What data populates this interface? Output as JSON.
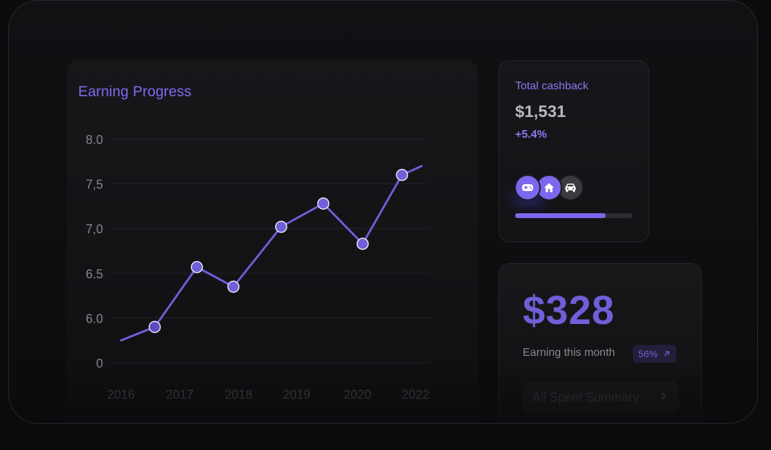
{
  "earning_card": {
    "title": "Earning Progress"
  },
  "chart_data": {
    "type": "line",
    "title": "Earning Progress",
    "y_tick_labels": [
      "8.0",
      "7,5",
      "7,0",
      "6.5",
      "6.0",
      "0"
    ],
    "x_tick_labels": [
      "2016",
      "2017",
      "2018",
      "2019",
      "2020",
      "2022"
    ],
    "grid": true,
    "series": [
      {
        "color": "#6f5fd8",
        "points": [
          {
            "x": 2016.0,
            "y": 5.75,
            "marker": false
          },
          {
            "x": 2016.6,
            "y": 5.9,
            "marker": true
          },
          {
            "x": 2017.35,
            "y": 6.57,
            "marker": true
          },
          {
            "x": 2018.0,
            "y": 6.35,
            "marker": true
          },
          {
            "x": 2018.85,
            "y": 7.02,
            "marker": true
          },
          {
            "x": 2019.6,
            "y": 7.28,
            "marker": true
          },
          {
            "x": 2020.3,
            "y": 6.83,
            "marker": true
          },
          {
            "x": 2021.0,
            "y": 7.6,
            "marker": true
          },
          {
            "x": 2021.35,
            "y": 7.7,
            "marker": false
          }
        ]
      }
    ]
  },
  "cashback": {
    "title": "Total cashback",
    "amount": "$1,531",
    "change": "+5.4%",
    "icons": [
      "gamepad-icon",
      "home-icon",
      "car-icon"
    ],
    "progress": 0.77
  },
  "month": {
    "amount": "$328",
    "label": "Earning this month",
    "badge_value": "56%",
    "badge_icon": "arrow-up-right-icon",
    "button_label": "All Spent Summary"
  },
  "colors": {
    "accent": "#7b68ee",
    "line": "#6f5fd8",
    "background": "#0b0b0d"
  }
}
